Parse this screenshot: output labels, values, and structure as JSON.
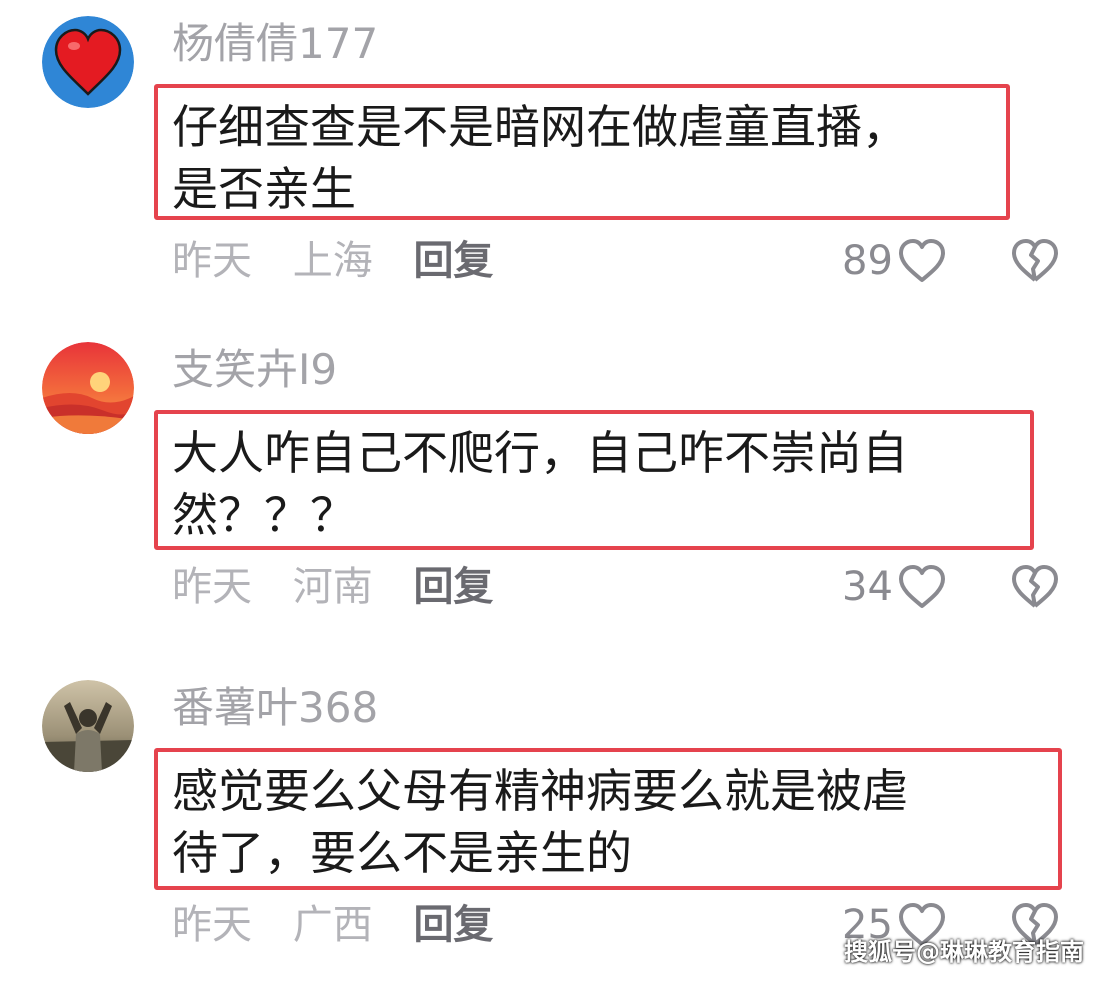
{
  "comments": [
    {
      "username": "杨倩倩177",
      "line1": "仔细查查是不是暗网在做虐童直播，",
      "line2": "是否亲生",
      "date": "昨天",
      "location": "上海",
      "reply": "回复",
      "likes": "89",
      "avatar": "red-heart"
    },
    {
      "username": "支笑卉I9",
      "line1": "大人咋自己不爬行，自己咋不崇尚自",
      "line2": "然？？？",
      "date": "昨天",
      "location": "河南",
      "reply": "回复",
      "likes": "34",
      "avatar": "sunset"
    },
    {
      "username": "番薯叶368",
      "line1": "感觉要么父母有精神病要么就是被虐",
      "line2": "待了，要么不是亲生的",
      "date": "昨天",
      "location": "广西",
      "reply": "回复",
      "likes": "25",
      "avatar": "person-photo"
    }
  ],
  "icons": {
    "like": "heart-outline-icon",
    "dislike": "broken-heart-icon"
  },
  "colors": {
    "highlight_border": "#e5434d",
    "username": "#a3a3a8",
    "meta": "#b3b3b8"
  },
  "watermark": "搜狐号@琳琳教育指南"
}
